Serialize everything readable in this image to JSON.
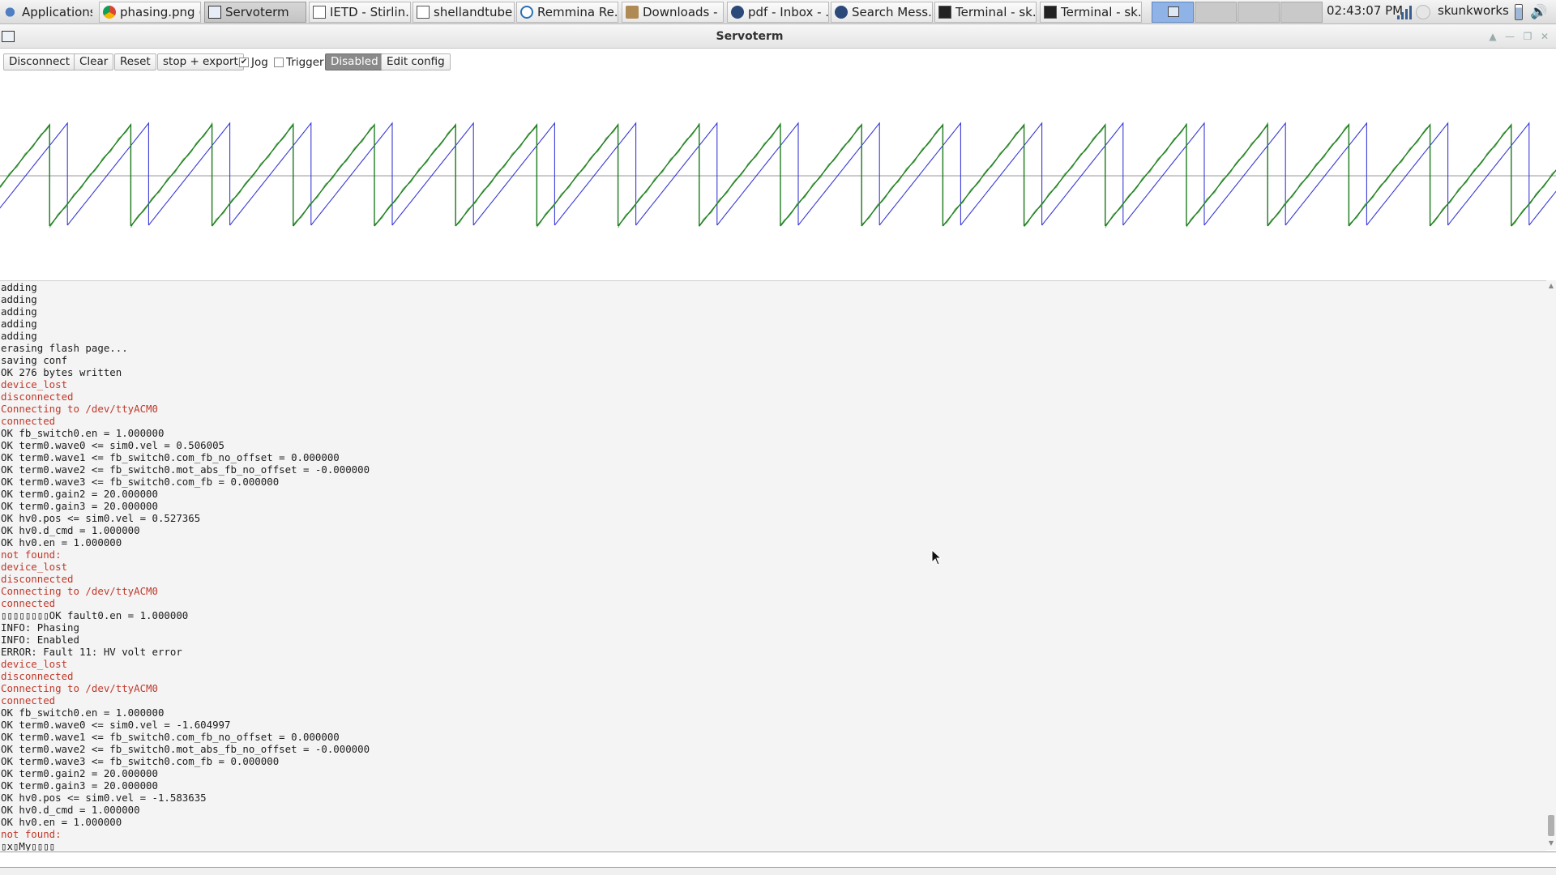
{
  "panel": {
    "apps_label": "Applications",
    "tasks": [
      {
        "label": "phasing.png (...",
        "icon": "chrome-icon"
      },
      {
        "label": "Servoterm",
        "icon": "servoterm-icon"
      },
      {
        "label": "IETD - Stirlin...",
        "icon": "document-icon"
      },
      {
        "label": "shellandtube ...",
        "icon": "document-icon"
      },
      {
        "label": "Remmina Re...",
        "icon": "remmina-icon"
      },
      {
        "label": "Downloads - ...",
        "icon": "folder-icon"
      },
      {
        "label": "pdf - Inbox - ...",
        "icon": "github-icon"
      },
      {
        "label": "Search Mess...",
        "icon": "github-icon"
      },
      {
        "label": "Terminal - sk...",
        "icon": "terminal-icon"
      },
      {
        "label": "Terminal - sk...",
        "icon": "terminal-icon"
      }
    ],
    "clock": "02:43:07 PM",
    "user": "skunkworks"
  },
  "window": {
    "title": "Servoterm"
  },
  "toolbar": {
    "disconnect": "Disconnect",
    "clear": "Clear",
    "reset": "Reset",
    "stop_export": "stop + export",
    "jog_label": "Jog",
    "jog_checked": true,
    "trigger_label": "Trigger",
    "trigger_checked": false,
    "disabled": "Disabled",
    "edit_config": "Edit config"
  },
  "colors": {
    "wave_green": "#1f7a1f",
    "wave_light_green": "#6fbf6f",
    "wave_blue": "#3a3ad6",
    "error_red": "#c0392b"
  },
  "log": [
    {
      "t": "adding",
      "red": false
    },
    {
      "t": "adding",
      "red": false
    },
    {
      "t": "adding",
      "red": false
    },
    {
      "t": "adding",
      "red": false
    },
    {
      "t": "adding",
      "red": false
    },
    {
      "t": "erasing flash page...",
      "red": false
    },
    {
      "t": "saving conf",
      "red": false
    },
    {
      "t": "OK 276 bytes written",
      "red": false
    },
    {
      "t": "device_lost",
      "red": true
    },
    {
      "t": "disconnected",
      "red": true
    },
    {
      "t": "Connecting to /dev/ttyACM0",
      "red": true
    },
    {
      "t": "connected",
      "red": true
    },
    {
      "t": "OK fb_switch0.en = 1.000000",
      "red": false
    },
    {
      "t": "OK term0.wave0 <= sim0.vel = 0.506005",
      "red": false
    },
    {
      "t": "OK term0.wave1 <= fb_switch0.com_fb_no_offset = 0.000000",
      "red": false
    },
    {
      "t": "OK term0.wave2 <= fb_switch0.mot_abs_fb_no_offset = -0.000000",
      "red": false
    },
    {
      "t": "OK term0.wave3 <= fb_switch0.com_fb = 0.000000",
      "red": false
    },
    {
      "t": "OK term0.gain2 = 20.000000",
      "red": false
    },
    {
      "t": "OK term0.gain3 = 20.000000",
      "red": false
    },
    {
      "t": "OK hv0.pos <= sim0.vel = 0.527365",
      "red": false
    },
    {
      "t": "OK hv0.d_cmd = 1.000000",
      "red": false
    },
    {
      "t": "OK hv0.en = 1.000000",
      "red": false
    },
    {
      "t": "not found:",
      "red": true
    },
    {
      "t": "device_lost",
      "red": true
    },
    {
      "t": "disconnected",
      "red": true
    },
    {
      "t": "Connecting to /dev/ttyACM0",
      "red": true
    },
    {
      "t": "connected",
      "red": true
    },
    {
      "t": "▯▯▯▯▯▯▯▯OK fault0.en = 1.000000",
      "red": false
    },
    {
      "t": "INFO: Phasing",
      "red": false
    },
    {
      "t": "INFO: Enabled",
      "red": false
    },
    {
      "t": "ERROR: Fault 11: HV volt error",
      "red": false
    },
    {
      "t": "device_lost",
      "red": true
    },
    {
      "t": "disconnected",
      "red": true
    },
    {
      "t": "Connecting to /dev/ttyACM0",
      "red": true
    },
    {
      "t": "connected",
      "red": true
    },
    {
      "t": "OK fb_switch0.en = 1.000000",
      "red": false
    },
    {
      "t": "OK term0.wave0 <= sim0.vel = -1.604997",
      "red": false
    },
    {
      "t": "OK term0.wave1 <= fb_switch0.com_fb_no_offset = 0.000000",
      "red": false
    },
    {
      "t": "OK term0.wave2 <= fb_switch0.mot_abs_fb_no_offset = -0.000000",
      "red": false
    },
    {
      "t": "OK term0.wave3 <= fb_switch0.com_fb = 0.000000",
      "red": false
    },
    {
      "t": "OK term0.gain2 = 20.000000",
      "red": false
    },
    {
      "t": "OK term0.gain3 = 20.000000",
      "red": false
    },
    {
      "t": "OK hv0.pos <= sim0.vel = -1.583635",
      "red": false
    },
    {
      "t": "OK hv0.d_cmd = 1.000000",
      "red": false
    },
    {
      "t": "OK hv0.en = 1.000000",
      "red": false
    },
    {
      "t": "not found:",
      "red": true
    },
    {
      "t": "▯x▯My▯▯▯▯",
      "red": false
    }
  ]
}
